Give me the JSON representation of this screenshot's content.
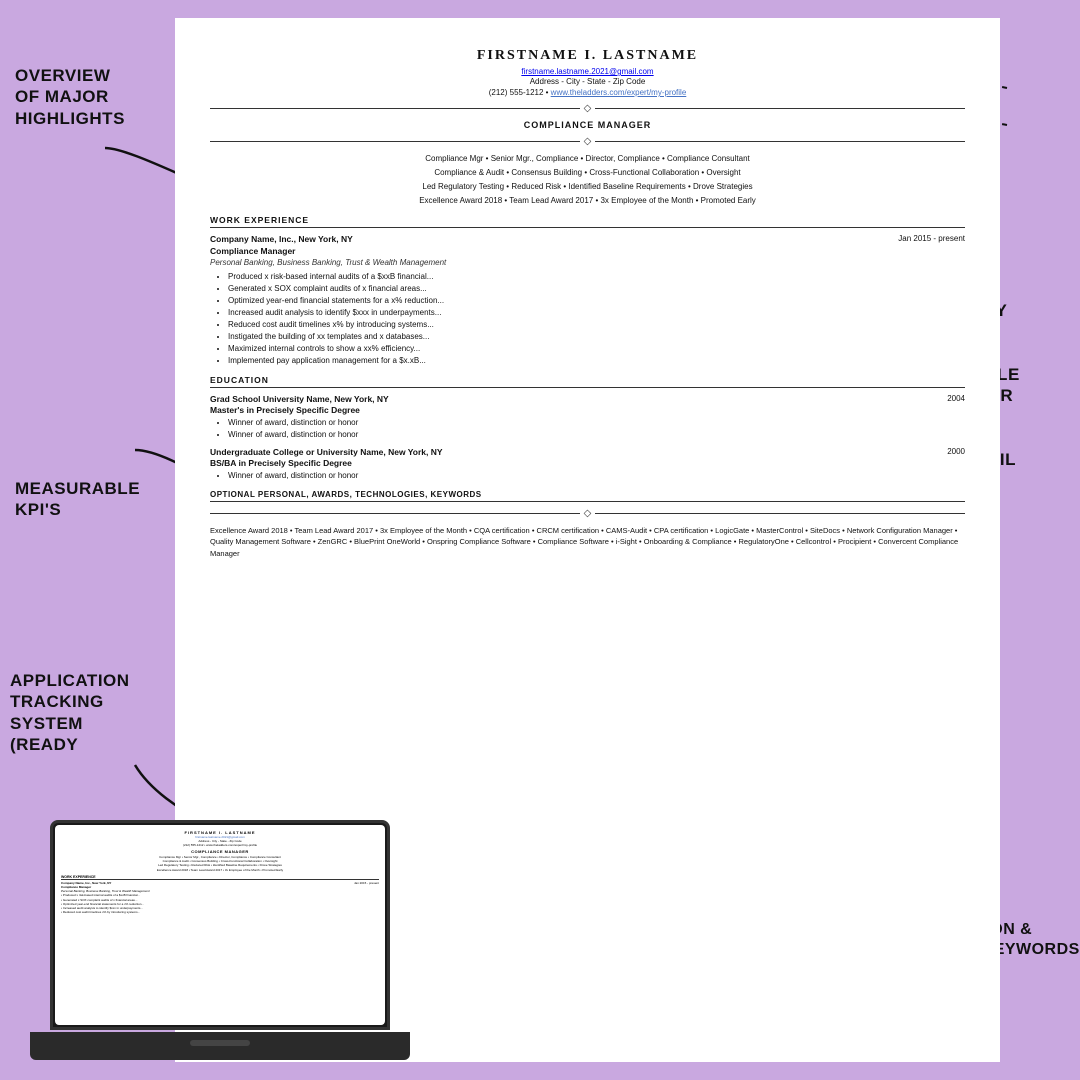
{
  "background_color": "#c9a8e0",
  "labels": {
    "overview": "OVERVIEW\nOF MAJOR\nHIGHLIGHTS",
    "kpis": "MEASURABLE\nKPI'S",
    "ats": "APPLICATION\nTRACKING\nSYSTEM\n(READY",
    "industry": "INDUSTRY\nSPECIFIC\nWITH\nCLICKABLE\nLINKS FOR\nLINKEDIN\nPROFILE\nAND EMAIL",
    "education": "EDUCATION &\nSKILLS/KEYWORDS"
  },
  "resume": {
    "name": "FIRSTNAME I. LASTNAME",
    "email": "firstname.lastname.2021@gmail.com",
    "address": "Address - City - State - Zip Code",
    "phone_linkedin": "(212) 555-1212 • www.theladders.com/expert/my-profile",
    "title": "COMPLIANCE MANAGER",
    "summary_line1": "Compliance Mgr • Senior Mgr., Compliance • Director, Compliance • Compliance Consultant",
    "summary_line2": "Compliance & Audit • Consensus Building • Cross-Functional Collaboration • Oversight",
    "summary_line3": "Led Regulatory Testing • Reduced Risk • Identified Baseline Requirements • Drove Strategies",
    "summary_line4": "Excellence Award 2018 • Team Lead Award 2017 • 3x Employee of the Month • Promoted Early",
    "work_experience_title": "WORK EXPERIENCE",
    "job1": {
      "company": "Company Name, Inc., New York, NY",
      "dates": "Jan 2015 - present",
      "title": "Compliance Manager",
      "subtitle": "Personal Banking, Business Banking, Trust & Wealth Management",
      "bullets": [
        "Produced x risk-based internal audits of a $xxB financial...",
        "Generated x SOX complaint audits of x financial areas...",
        "Optimized year-end financial statements for a x% reduction...",
        "Increased audit analysis to identify $xxx in underpayments...",
        "Reduced cost audit timelines x% by introducing systems...",
        "Instigated the building of xx templates and x databases...",
        "Maximized internal controls to show a xx% efficiency...",
        "Implemented pay application management for a $x.xB..."
      ]
    },
    "education_title": "EDUCATION",
    "edu1": {
      "school": "Grad School University Name, New York, NY",
      "year": "2004",
      "degree": "Master's in Precisely Specific Degree",
      "bullets": [
        "Winner of award, distinction or honor",
        "Winner of award, distinction or honor"
      ]
    },
    "edu2": {
      "school": "Undergraduate College or University Name, New York, NY",
      "year": "2000",
      "degree": "BS/BA in Precisely Specific Degree",
      "bullets": [
        "Winner of award, distinction or honor"
      ]
    },
    "optional_title": "OPTIONAL PERSONAL, AWARDS, TECHNOLOGIES, KEYWORDS",
    "optional_text": "Excellence Award 2018 • Team Lead Award 2017 • 3x Employee of the Month • CQA certification • CRCM certification • CAMS-Audit • CPA certification • LogicGate • MasterControl • SiteDocs • Network Configuration Manager • Quality Management Software • ZenGRC • BluePrint OneWorld • Onspring Compliance Software • Compliance Software • i-Sight • Onboarding & Compliance • RegulatoryOne • Cellcontrol • Procipient • Convercent Compliance Manager"
  }
}
